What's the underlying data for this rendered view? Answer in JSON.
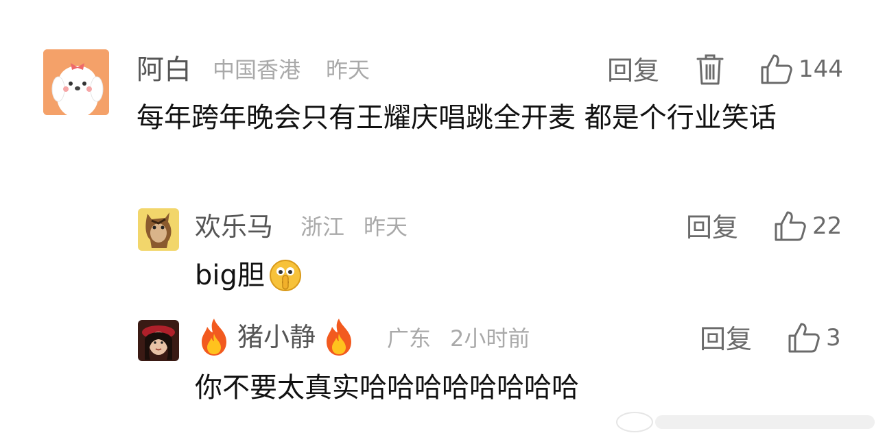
{
  "comments": [
    {
      "user": "阿白",
      "location": "中国香港",
      "time": "昨天",
      "reply_label": "回复",
      "likes": "144",
      "text": "每年跨年晚会只有王耀庆唱跳全开麦 都是个行业笑话"
    },
    {
      "user": "欢乐马",
      "location": "浙江",
      "time": "昨天",
      "reply_label": "回复",
      "likes": "22",
      "text": "big胆"
    },
    {
      "user": "猪小静",
      "location": "广东",
      "time": "2小时前",
      "reply_label": "回复",
      "likes": "3",
      "text": "你不要太真实哈哈哈哈哈哈哈哈"
    }
  ],
  "icons": {
    "delete": "trash-icon",
    "like": "thumbs-up-icon",
    "fire": "fire-icon",
    "shush": "shushing-face-icon"
  },
  "colors": {
    "name": "#555555",
    "meta": "#a9a9a9",
    "text": "#111111"
  }
}
